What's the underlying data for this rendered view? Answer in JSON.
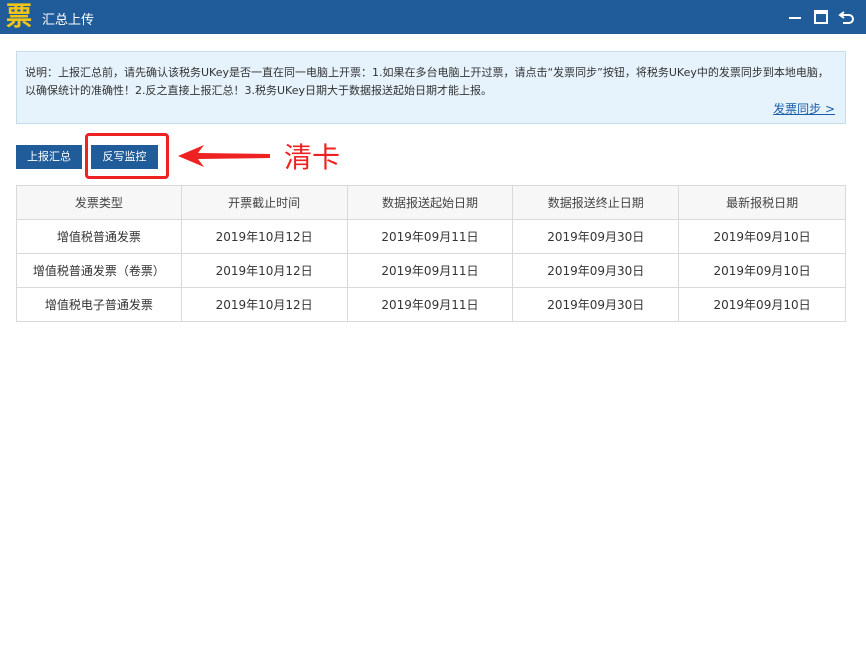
{
  "window": {
    "logo_char": "票",
    "title": "汇总上传",
    "controls": [
      "minimize-icon",
      "maximize-icon",
      "back-icon"
    ]
  },
  "notice": {
    "text": "说明：上报汇总前，请先确认该税务UKey是否一直在同一电脑上开票：1.如果在多台电脑上开过票，请点击“发票同步”按钮，将税务UKey中的发票同步到本地电脑，以确保统计的准确性！2.反之直接上报汇总！3.税务UKey日期大于数据报送起始日期才能上报。",
    "sync_link": "发票同步 >"
  },
  "toolbar": {
    "upload_label": "上报汇总",
    "writeback_label": "反写监控"
  },
  "annotation": {
    "text": "清卡",
    "color": "#ee2222"
  },
  "table": {
    "headers": [
      "发票类型",
      "开票截止时间",
      "数据报送起始日期",
      "数据报送终止日期",
      "最新报税日期"
    ],
    "rows": [
      [
        "增值税普通发票",
        "2019年10月12日",
        "2019年09月11日",
        "2019年09月30日",
        "2019年09月10日"
      ],
      [
        "增值税普通发票（卷票）",
        "2019年10月12日",
        "2019年09月11日",
        "2019年09月30日",
        "2019年09月10日"
      ],
      [
        "增值税电子普通发票",
        "2019年10月12日",
        "2019年09月11日",
        "2019年09月30日",
        "2019年09月10日"
      ]
    ]
  },
  "colors": {
    "titlebar": "#1f5c99",
    "accent_button": "#1f5c99",
    "notice_bg": "#e6f3fc"
  }
}
